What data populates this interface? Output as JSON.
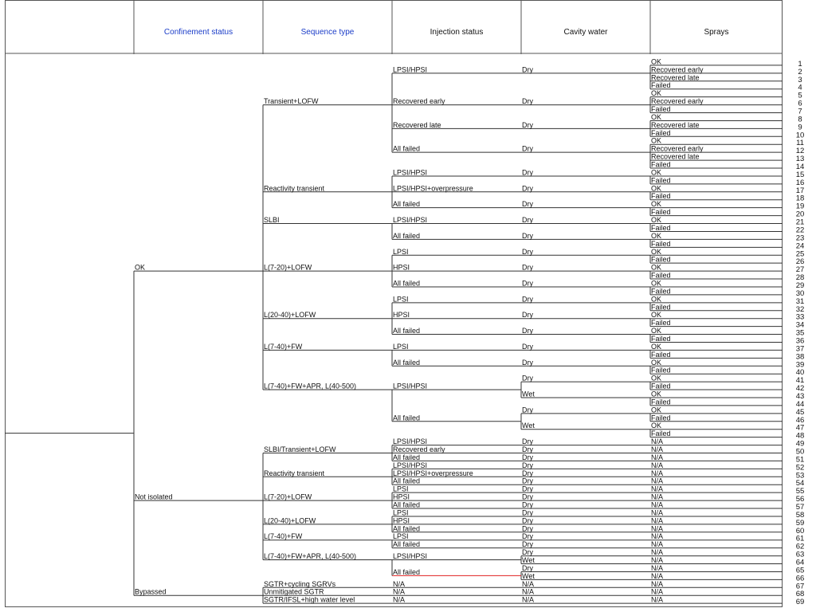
{
  "header": {
    "confinement": "Confinement status",
    "sequence": "Sequence type",
    "injection": "Injection status",
    "cavity": "Cavity water",
    "sprays": "Sprays"
  },
  "colors": {
    "header_accent": "#1a3cc8",
    "highlight": "#e02020"
  },
  "confinement": [
    {
      "label": "OK"
    },
    {
      "label": "Not isolated"
    },
    {
      "label": "Bypassed"
    }
  ],
  "sequences": [
    {
      "label": "Transient+LOFW",
      "conf": 0,
      "injections": [
        {
          "label": "LPSI/HPSI",
          "branches": [
            {
              "cavity": "Dry",
              "sprays": [
                "OK",
                "Recovered early",
                "Recovered late",
                "Failed"
              ]
            }
          ]
        },
        {
          "label": "Recovered early",
          "branches": [
            {
              "cavity": "Dry",
              "sprays": [
                "OK",
                "Recovered early",
                "Failed"
              ]
            }
          ]
        },
        {
          "label": "Recovered late",
          "branches": [
            {
              "cavity": "Dry",
              "sprays": [
                "OK",
                "Recovered late",
                "Failed"
              ]
            }
          ]
        },
        {
          "label": "All failed",
          "branches": [
            {
              "cavity": "Dry",
              "sprays": [
                "OK",
                "Recovered early",
                "Recovered late",
                "Failed"
              ]
            }
          ]
        }
      ]
    },
    {
      "label": "Reactivity transient",
      "conf": 0,
      "injections": [
        {
          "label": "LPSI/HPSI",
          "branches": [
            {
              "cavity": "Dry",
              "sprays": [
                "OK",
                "Failed"
              ]
            }
          ]
        },
        {
          "label": "LPSI/HPSI+overpressure",
          "branches": [
            {
              "cavity": "Dry",
              "sprays": [
                "OK",
                "Failed"
              ]
            }
          ]
        },
        {
          "label": "All failed",
          "branches": [
            {
              "cavity": "Dry",
              "sprays": [
                "OK",
                "Failed"
              ]
            }
          ]
        }
      ]
    },
    {
      "label": "SLBI",
      "conf": 0,
      "injections": [
        {
          "label": "LPSI/HPSI",
          "branches": [
            {
              "cavity": "Dry",
              "sprays": [
                "OK",
                "Failed"
              ]
            }
          ]
        },
        {
          "label": "All failed",
          "branches": [
            {
              "cavity": "Dry",
              "sprays": [
                "OK",
                "Failed"
              ]
            }
          ]
        }
      ]
    },
    {
      "label": "L(7-20)+LOFW",
      "conf": 0,
      "injections": [
        {
          "label": "LPSI",
          "branches": [
            {
              "cavity": "Dry",
              "sprays": [
                "OK",
                "Failed"
              ]
            }
          ]
        },
        {
          "label": "HPSI",
          "branches": [
            {
              "cavity": "Dry",
              "sprays": [
                "OK",
                "Failed"
              ]
            }
          ]
        },
        {
          "label": "All failed",
          "branches": [
            {
              "cavity": "Dry",
              "sprays": [
                "OK",
                "Failed"
              ]
            }
          ]
        }
      ]
    },
    {
      "label": "L(20-40)+LOFW",
      "conf": 0,
      "injections": [
        {
          "label": "LPSI",
          "branches": [
            {
              "cavity": "Dry",
              "sprays": [
                "OK",
                "Failed"
              ]
            }
          ]
        },
        {
          "label": "HPSI",
          "branches": [
            {
              "cavity": "Dry",
              "sprays": [
                "OK",
                "Failed"
              ]
            }
          ]
        },
        {
          "label": "All failed",
          "branches": [
            {
              "cavity": "Dry",
              "sprays": [
                "OK",
                "Failed"
              ]
            }
          ]
        }
      ]
    },
    {
      "label": "L(7-40)+FW",
      "conf": 0,
      "injections": [
        {
          "label": "LPSI",
          "branches": [
            {
              "cavity": "Dry",
              "sprays": [
                "OK",
                "Failed"
              ]
            }
          ]
        },
        {
          "label": "All failed",
          "branches": [
            {
              "cavity": "Dry",
              "sprays": [
                "OK",
                "Failed"
              ]
            }
          ]
        }
      ]
    },
    {
      "label": "L(7-40)+FW+APR, L(40-500)",
      "conf": 0,
      "injections": [
        {
          "label": "LPSI/HPSI",
          "branches": [
            {
              "cavity": "Dry",
              "sprays": [
                "OK",
                "Failed"
              ]
            },
            {
              "cavity": "Wet",
              "sprays": [
                "OK",
                "Failed"
              ]
            }
          ]
        },
        {
          "label": "All failed",
          "branches": [
            {
              "cavity": "Dry",
              "sprays": [
                "OK",
                "Failed"
              ]
            },
            {
              "cavity": "Wet",
              "sprays": [
                "OK",
                "Failed"
              ]
            }
          ]
        }
      ]
    },
    {
      "label": "SLBI/Transient+LOFW",
      "conf": 1,
      "injections": [
        {
          "label": "LPSI/HPSI",
          "branches": [
            {
              "cavity": "Dry",
              "sprays": [
                "N/A"
              ]
            }
          ]
        },
        {
          "label": "Recovered early",
          "branches": [
            {
              "cavity": "Dry",
              "sprays": [
                "N/A"
              ]
            }
          ]
        },
        {
          "label": "All failed",
          "branches": [
            {
              "cavity": "Dry",
              "sprays": [
                "N/A"
              ]
            }
          ]
        }
      ]
    },
    {
      "label": "Reactivity transient",
      "conf": 1,
      "injections": [
        {
          "label": "LPSI/HPSI",
          "branches": [
            {
              "cavity": "Dry",
              "sprays": [
                "N/A"
              ]
            }
          ]
        },
        {
          "label": "LPSI/HPSI+overpressure",
          "branches": [
            {
              "cavity": "Dry",
              "sprays": [
                "N/A"
              ]
            }
          ]
        },
        {
          "label": "All failed",
          "branches": [
            {
              "cavity": "Dry",
              "sprays": [
                "N/A"
              ]
            }
          ]
        }
      ]
    },
    {
      "label": "L(7-20)+LOFW",
      "conf": 1,
      "injections": [
        {
          "label": "LPSI",
          "branches": [
            {
              "cavity": "Dry",
              "sprays": [
                "N/A"
              ]
            }
          ]
        },
        {
          "label": "HPSI",
          "branches": [
            {
              "cavity": "Dry",
              "sprays": [
                "N/A"
              ]
            }
          ]
        },
        {
          "label": "All failed",
          "branches": [
            {
              "cavity": "Dry",
              "sprays": [
                "N/A"
              ]
            }
          ]
        }
      ]
    },
    {
      "label": "L(20-40)+LOFW",
      "conf": 1,
      "injections": [
        {
          "label": "LPSI",
          "branches": [
            {
              "cavity": "Dry",
              "sprays": [
                "N/A"
              ]
            }
          ]
        },
        {
          "label": "HPSI",
          "branches": [
            {
              "cavity": "Dry",
              "sprays": [
                "N/A"
              ]
            }
          ]
        },
        {
          "label": "All failed",
          "branches": [
            {
              "cavity": "Dry",
              "sprays": [
                "N/A"
              ]
            }
          ]
        }
      ]
    },
    {
      "label": "L(7-40)+FW",
      "conf": 1,
      "injections": [
        {
          "label": "LPSI",
          "branches": [
            {
              "cavity": "Dry",
              "sprays": [
                "N/A"
              ]
            }
          ]
        },
        {
          "label": "All failed",
          "branches": [
            {
              "cavity": "Dry",
              "sprays": [
                "N/A"
              ]
            }
          ]
        }
      ]
    },
    {
      "label": "L(7-40)+FW+APR, L(40-500)",
      "conf": 1,
      "injections": [
        {
          "label": "LPSI/HPSI",
          "branches": [
            {
              "cavity": "Dry",
              "sprays": [
                "N/A"
              ]
            },
            {
              "cavity": "Wet",
              "sprays": [
                "N/A"
              ]
            }
          ]
        },
        {
          "label": "All failed",
          "highlight": true,
          "branches": [
            {
              "cavity": "Dry",
              "sprays": [
                "N/A"
              ]
            },
            {
              "cavity": "Wet",
              "sprays": [
                "N/A"
              ]
            }
          ]
        }
      ]
    },
    {
      "label": "SGTR+cycling SGRVs",
      "conf": 2,
      "injections": [
        {
          "label": "N/A",
          "branches": [
            {
              "cavity": "N/A",
              "sprays": [
                "N/A"
              ]
            }
          ]
        }
      ]
    },
    {
      "label": "Unmitigated SGTR",
      "conf": 2,
      "injections": [
        {
          "label": "N/A",
          "branches": [
            {
              "cavity": "N/A",
              "sprays": [
                "N/A"
              ]
            }
          ]
        }
      ]
    },
    {
      "label": "SGTR/IFSL+high water level",
      "conf": 2,
      "injections": [
        {
          "label": "N/A",
          "branches": [
            {
              "cavity": "N/A",
              "sprays": [
                "N/A"
              ]
            }
          ]
        }
      ]
    }
  ]
}
